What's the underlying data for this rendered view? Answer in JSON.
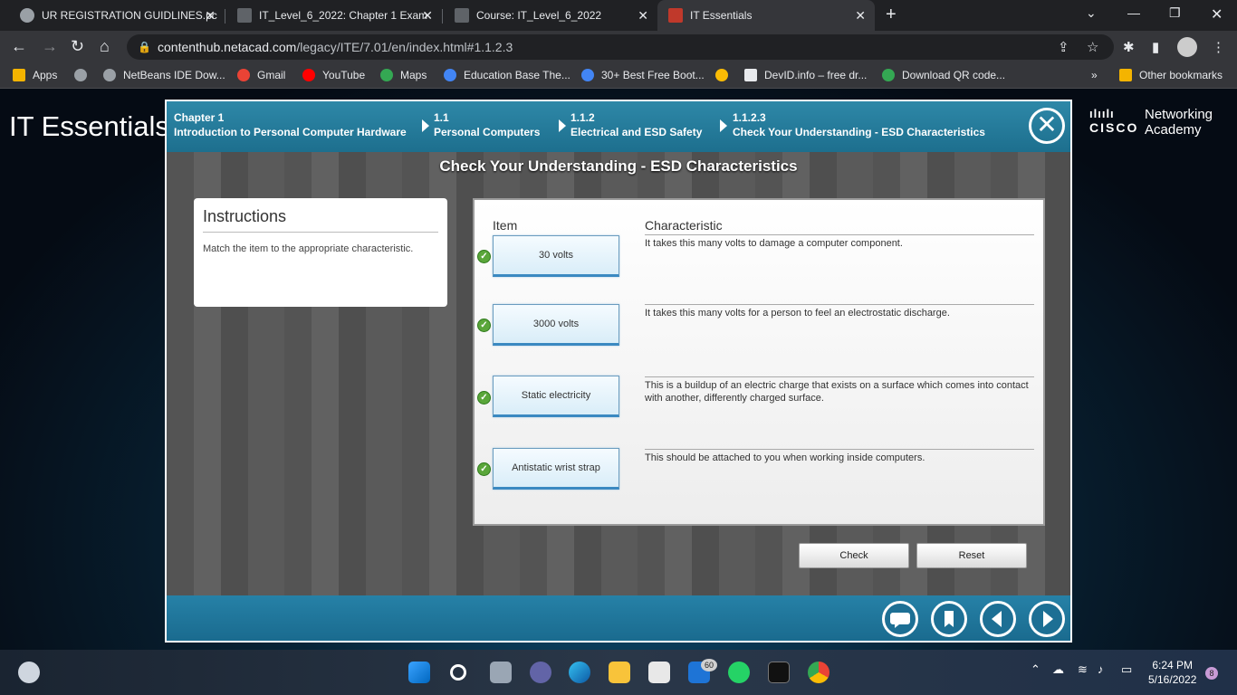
{
  "browser": {
    "tabs": [
      {
        "title": "UR REGISTRATION GUIDLINES.pc",
        "close": "✕"
      },
      {
        "title": "IT_Level_6_2022: Chapter 1 Exam",
        "close": "✕"
      },
      {
        "title": "Course: IT_Level_6_2022",
        "close": "✕"
      },
      {
        "title": "IT Essentials",
        "close": "✕"
      }
    ],
    "new_tab": "+",
    "url_host": "contenthub.netacad.com",
    "url_path": "/legacy/ITE/7.01/en/index.html#1.1.2.3",
    "bookmarks": [
      {
        "label": "Apps",
        "color": "#f4b400"
      },
      {
        "label": "",
        "color": "#9aa0a6"
      },
      {
        "label": "NetBeans IDE Dow...",
        "color": "#9aa0a6"
      },
      {
        "label": "Gmail",
        "color": "#ea4335"
      },
      {
        "label": "YouTube",
        "color": "#ff0000"
      },
      {
        "label": "Maps",
        "color": "#34a853"
      },
      {
        "label": "Education Base The...",
        "color": "#4285f4"
      },
      {
        "label": "30+ Best Free Boot...",
        "color": "#4285f4"
      },
      {
        "label": "",
        "color": "#fbbc05"
      },
      {
        "label": "DevID.info – free dr...",
        "color": "#e8eaed"
      },
      {
        "label": "Download QR code...",
        "color": "#34a853"
      }
    ],
    "more_bookmarks": "»",
    "other_bookmarks": "Other bookmarks"
  },
  "site": {
    "title": "IT Essentials",
    "logo_bars": "ılıılı",
    "logo_word": "CISCO",
    "logo_networking": "Networking",
    "logo_academy": "Academy"
  },
  "breadcrumb": [
    {
      "top": "Chapter 1",
      "bottom": "Introduction to Personal Computer Hardware"
    },
    {
      "top": "1.1",
      "bottom": "Personal Computers"
    },
    {
      "top": "1.1.2",
      "bottom": "Electrical and ESD Safety"
    },
    {
      "top": "1.1.2.3",
      "bottom": "Check Your Understanding - ESD Characteristics"
    }
  ],
  "close_glyph": "✕",
  "activity": {
    "title": "Check Your Understanding - ESD Characteristics",
    "instructions_heading": "Instructions",
    "instructions_text": "Match the item to the appropriate characteristic.",
    "item_header": "Item",
    "characteristic_header": "Characteristic",
    "check_glyph": "✓",
    "rows": [
      {
        "item": "30 volts",
        "characteristic": "It takes this many volts to damage a computer component."
      },
      {
        "item": "3000 volts",
        "characteristic": "It takes this many volts for a person to feel an electrostatic discharge."
      },
      {
        "item": "Static electricity",
        "characteristic": "This is a buildup of an electric charge that exists on a surface which comes into contact with another, differently charged surface."
      },
      {
        "item": "Antistatic wrist strap",
        "characteristic": "This should be attached to you when working inside computers."
      }
    ],
    "check_label": "Check",
    "reset_label": "Reset"
  },
  "taskbar": {
    "time": "6:24 PM",
    "date": "5/16/2022",
    "notification_count": "8",
    "mail_badge": "60"
  }
}
